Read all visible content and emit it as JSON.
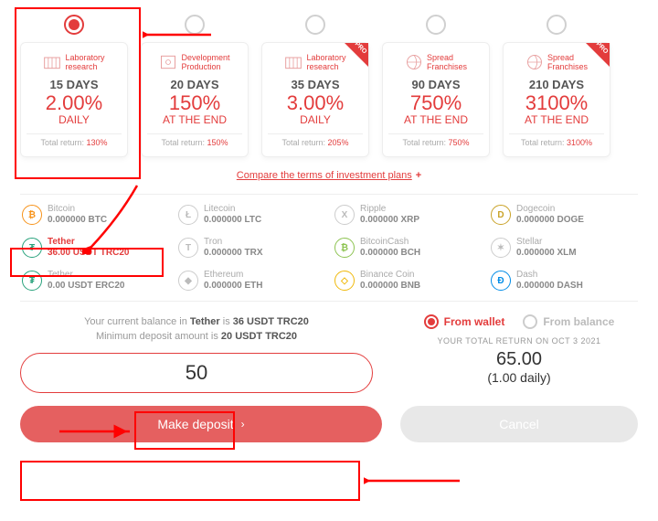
{
  "plans": [
    {
      "title": "Laboratory research",
      "icon": "lab",
      "days": "15 DAYS",
      "rate": "2.00%",
      "mode": "DAILY",
      "total_label": "Total return:",
      "total": "130%",
      "pro": false,
      "selected": true
    },
    {
      "title": "Development Production",
      "icon": "dev",
      "days": "20 DAYS",
      "rate": "150%",
      "mode": "AT THE END",
      "total_label": "Total return:",
      "total": "150%",
      "pro": false,
      "selected": false
    },
    {
      "title": "Laboratory research",
      "icon": "lab",
      "days": "35 DAYS",
      "rate": "3.00%",
      "mode": "DAILY",
      "total_label": "Total return:",
      "total": "205%",
      "pro": true,
      "selected": false
    },
    {
      "title": "Spread Franchises",
      "icon": "spread",
      "days": "90 DAYS",
      "rate": "750%",
      "mode": "AT THE END",
      "total_label": "Total return:",
      "total": "750%",
      "pro": false,
      "selected": false
    },
    {
      "title": "Spread Franchises",
      "icon": "spread",
      "days": "210 DAYS",
      "rate": "3100%",
      "mode": "AT THE END",
      "total_label": "Total return:",
      "total": "3100%",
      "pro": true,
      "selected": false
    }
  ],
  "compare_label": "Compare the terms of investment plans",
  "pro_badge": "PRO",
  "currencies": [
    {
      "name": "Bitcoin",
      "balance": "0.000000 BTC",
      "glyph": "₿",
      "cls": "btc",
      "selected": false
    },
    {
      "name": "Litecoin",
      "balance": "0.000000 LTC",
      "glyph": "Ł",
      "cls": "",
      "selected": false
    },
    {
      "name": "Ripple",
      "balance": "0.000000 XRP",
      "glyph": "X",
      "cls": "",
      "selected": false
    },
    {
      "name": "Dogecoin",
      "balance": "0.000000 DOGE",
      "glyph": "D",
      "cls": "doge",
      "selected": false
    },
    {
      "name": "Tether",
      "balance": "36.00 USDT TRC20",
      "glyph": "₮",
      "cls": "tether",
      "selected": true
    },
    {
      "name": "Tron",
      "balance": "0.000000 TRX",
      "glyph": "T",
      "cls": "",
      "selected": false
    },
    {
      "name": "BitcoinCash",
      "balance": "0.000000 BCH",
      "glyph": "₿",
      "cls": "bch",
      "selected": false
    },
    {
      "name": "Stellar",
      "balance": "0.000000 XLM",
      "glyph": "✶",
      "cls": "",
      "selected": false
    },
    {
      "name": "Tether",
      "balance": "0.00 USDT ERC20",
      "glyph": "₮",
      "cls": "tether",
      "selected": false
    },
    {
      "name": "Ethereum",
      "balance": "0.000000 ETH",
      "glyph": "◆",
      "cls": "",
      "selected": false
    },
    {
      "name": "Binance Coin",
      "balance": "0.000000 BNB",
      "glyph": "◇",
      "cls": "bnb",
      "selected": false
    },
    {
      "name": "Dash",
      "balance": "0.000000 DASH",
      "glyph": "Đ",
      "cls": "dash",
      "selected": false
    }
  ],
  "balance_info": {
    "line1_a": "Your current balance in ",
    "line1_b_bold": "Tether",
    "line1_c": " is ",
    "line1_d_bold": "36 USDT TRC20",
    "line2_a": "Minimum deposit amount is ",
    "line2_b_bold": "20 USDT TRC20"
  },
  "amount_value": "50",
  "source": {
    "from_wallet": "From wallet",
    "from_balance": "From balance"
  },
  "returns": {
    "label": "YOUR TOTAL RETURN ON OCT 3 2021",
    "total": "65.00",
    "daily": "(1.00 daily)"
  },
  "buttons": {
    "deposit": "Make deposit",
    "cancel": "Cancel"
  }
}
